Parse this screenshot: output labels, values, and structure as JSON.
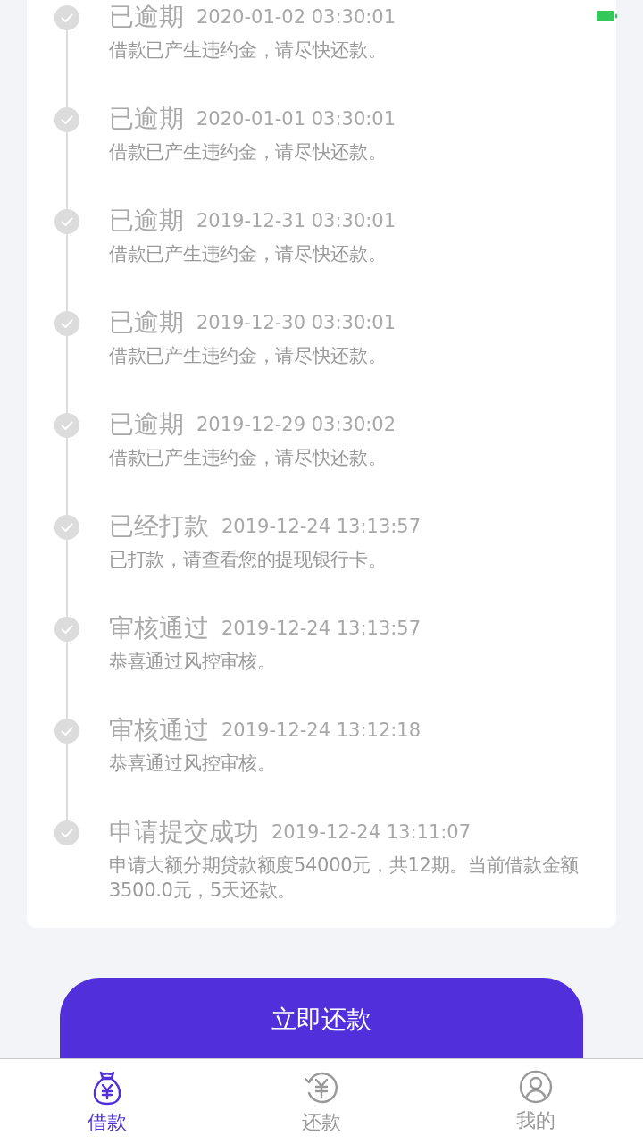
{
  "timeline": [
    {
      "title": "已逾期",
      "time": "2020-01-02 03:30:01",
      "desc": "借款已产生违约金，请尽快还款。"
    },
    {
      "title": "已逾期",
      "time": "2020-01-01 03:30:01",
      "desc": "借款已产生违约金，请尽快还款。"
    },
    {
      "title": "已逾期",
      "time": "2019-12-31 03:30:01",
      "desc": "借款已产生违约金，请尽快还款。"
    },
    {
      "title": "已逾期",
      "time": "2019-12-30 03:30:01",
      "desc": "借款已产生违约金，请尽快还款。"
    },
    {
      "title": "已逾期",
      "time": "2019-12-29 03:30:02",
      "desc": "借款已产生违约金，请尽快还款。"
    },
    {
      "title": "已经打款",
      "time": "2019-12-24 13:13:57",
      "desc": "已打款，请查看您的提现银行卡。"
    },
    {
      "title": "审核通过",
      "time": "2019-12-24 13:13:57",
      "desc": "恭喜通过风控审核。"
    },
    {
      "title": "审核通过",
      "time": "2019-12-24 13:12:18",
      "desc": "恭喜通过风控审核。"
    },
    {
      "title": "申请提交成功",
      "time": "2019-12-24 13:11:07",
      "desc": "申请大额分期贷款额度54000元，共12期。当前借款金额3500.0元，5天还款。"
    }
  ],
  "repay_button": "立即还款",
  "tabs": [
    {
      "label": "借款",
      "kind": "bag",
      "selected": true
    },
    {
      "label": "还款",
      "kind": "refund",
      "selected": false
    },
    {
      "label": "我的",
      "kind": "user",
      "selected": false
    }
  ]
}
